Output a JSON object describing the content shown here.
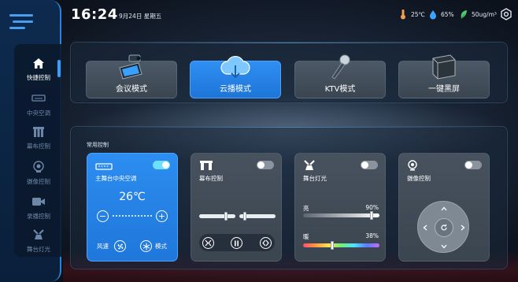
{
  "header": {
    "time": "16:24",
    "date": "9月24日 星期五",
    "temperature": "25℃",
    "humidity": "65%",
    "air_quality": "50ug/m³"
  },
  "sidebar": {
    "items": [
      {
        "label": "快捷控制",
        "icon": "home-icon",
        "active": true
      },
      {
        "label": "中央空调",
        "icon": "air-conditioner-icon",
        "active": false
      },
      {
        "label": "幕布控制",
        "icon": "curtain-icon",
        "active": false
      },
      {
        "label": "摄像控制",
        "icon": "camera-icon",
        "active": false
      },
      {
        "label": "录播控制",
        "icon": "video-record-icon",
        "active": false
      },
      {
        "label": "舞台灯光",
        "icon": "stage-light-icon",
        "active": false
      }
    ]
  },
  "modes": [
    {
      "label": "会议模式",
      "icon": "projector-icon",
      "active": false
    },
    {
      "label": "云播模式",
      "icon": "cloud-icon",
      "active": true
    },
    {
      "label": "KTV模式",
      "icon": "microphone-icon",
      "active": false
    },
    {
      "label": "一键黑屏",
      "icon": "black-screen-icon",
      "active": false
    }
  ],
  "common_controls": {
    "title": "常用控制",
    "ac": {
      "title": "主舞台中央空调",
      "on": true,
      "temperature": "26℃",
      "decrease": "−",
      "increase": "+",
      "fan_label": "风速",
      "mode_label": "模式"
    },
    "curtain": {
      "title": "幕布控制",
      "on": false,
      "slider_a": 0.73,
      "slider_b": 0.15
    },
    "lighting": {
      "title": "舞台灯光",
      "on": false,
      "brightness_label": "亮",
      "brightness_value": "90%",
      "brightness": 0.9,
      "warmth_label": "暖",
      "warmth_value": "38%",
      "warmth": 0.38
    },
    "camera": {
      "title": "摄像控制",
      "on": false
    }
  },
  "colors": {
    "accent": "#2f8ff2",
    "sidebar_border": "#2d82d8",
    "toggle_on": "#6ee0ff"
  }
}
